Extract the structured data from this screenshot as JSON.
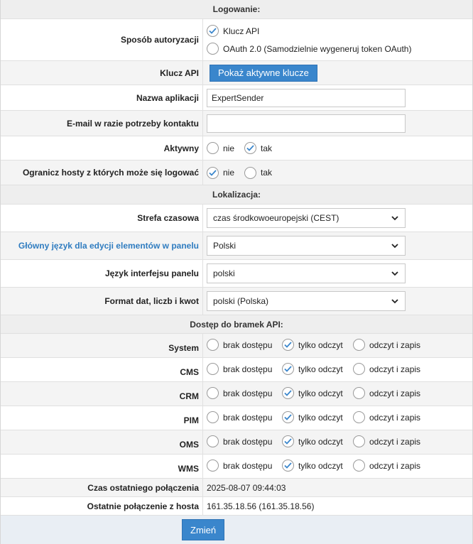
{
  "sections": {
    "login": "Logowanie:",
    "localization": "Lokalizacja:",
    "api_access": "Dostęp do bramek API:"
  },
  "auth": {
    "label": "Sposób autoryzacji",
    "option_api_key": "Klucz API",
    "option_oauth": "OAuth 2.0 (Samodzielnie wygeneruj token OAuth)",
    "selected": "api_key"
  },
  "api_key": {
    "label": "Klucz API",
    "button": "Pokaż aktywne klucze"
  },
  "app_name": {
    "label": "Nazwa aplikacji",
    "value": "ExpertSender"
  },
  "contact_email": {
    "label": "E-mail w razie potrzeby kontaktu",
    "value": ""
  },
  "active": {
    "label": "Aktywny",
    "no": "nie",
    "yes": "tak",
    "selected": "yes"
  },
  "limit_hosts": {
    "label": "Ogranicz hosty z których może się logować",
    "no": "nie",
    "yes": "tak",
    "selected": "no"
  },
  "timezone": {
    "label": "Strefa czasowa",
    "value": "czas środkowoeuropejski (CEST)"
  },
  "main_language": {
    "label": "Główny język dla edycji elementów w panelu",
    "value": "Polski"
  },
  "ui_language": {
    "label": "Język interfejsu panelu",
    "value": "polski"
  },
  "format": {
    "label": "Format dat, liczb i kwot",
    "value": "polski (Polska)"
  },
  "access_options": {
    "none": "brak dostępu",
    "read": "tylko odczyt",
    "readwrite": "odczyt i zapis"
  },
  "gateways": [
    {
      "name": "System",
      "selected": "read"
    },
    {
      "name": "CMS",
      "selected": "read"
    },
    {
      "name": "CRM",
      "selected": "read"
    },
    {
      "name": "PIM",
      "selected": "read"
    },
    {
      "name": "OMS",
      "selected": "read"
    },
    {
      "name": "WMS",
      "selected": "read"
    }
  ],
  "last_connection": {
    "label": "Czas ostatniego połączenia",
    "value": "2025-08-07 09:44:03"
  },
  "last_host": {
    "label": "Ostatnie połączenie z hosta",
    "value": "161.35.18.56 (161.35.18.56)"
  },
  "submit": {
    "label": "Zmień"
  },
  "colors": {
    "accent": "#3a86cc",
    "check": "#3a86cc",
    "link_label": "#2f7cc0"
  }
}
